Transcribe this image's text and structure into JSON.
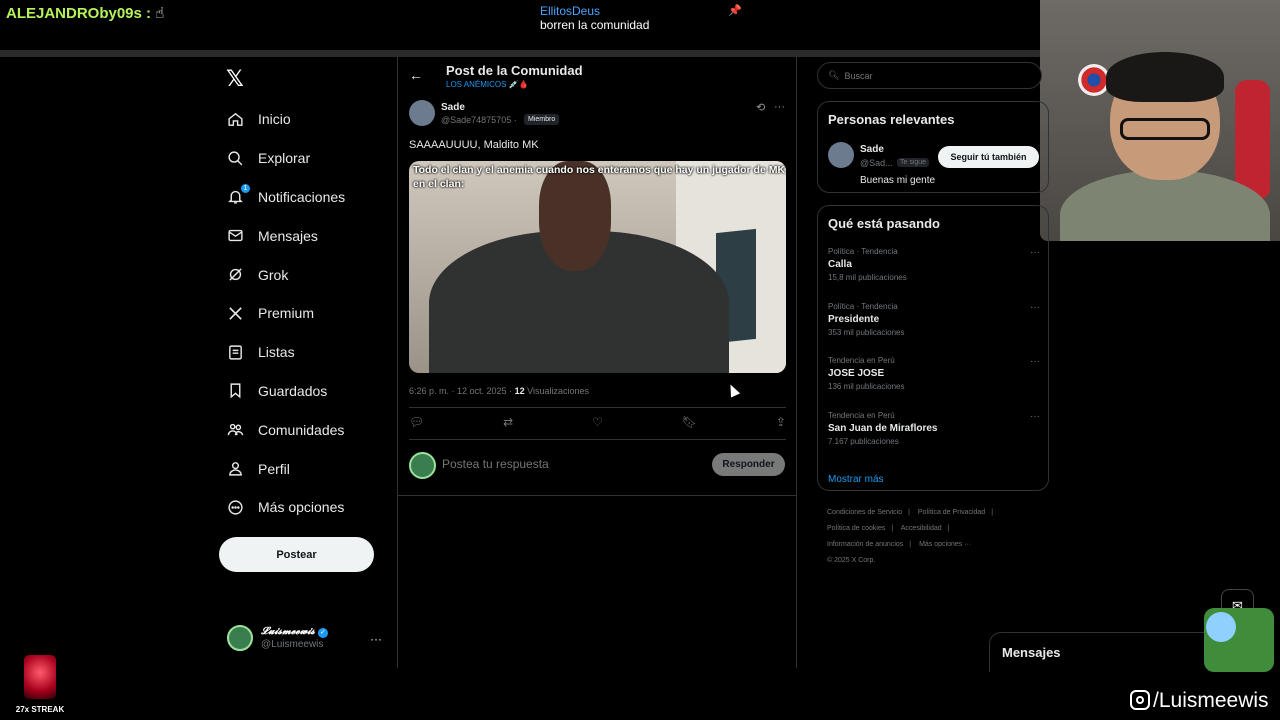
{
  "stream": {
    "chat_left": {
      "user": "ALEJANDROby09s",
      "sep": ":",
      "emoji": "☝"
    },
    "chat_center": {
      "user": "EllitosDeus",
      "message": "borren la comunidad"
    },
    "streak_label": "27x STREAK",
    "instagram": "/Luismeewis"
  },
  "nav": {
    "logo": "𝕏",
    "items": [
      {
        "label": "Inicio",
        "icon": "home-icon"
      },
      {
        "label": "Explorar",
        "icon": "search-icon"
      },
      {
        "label": "Notificaciones",
        "icon": "bell-icon",
        "badge": "1"
      },
      {
        "label": "Mensajes",
        "icon": "mail-icon"
      },
      {
        "label": "Grok",
        "icon": "grok-icon"
      },
      {
        "label": "Premium",
        "icon": "x-icon"
      },
      {
        "label": "Listas",
        "icon": "list-icon"
      },
      {
        "label": "Guardados",
        "icon": "bookmark-icon"
      },
      {
        "label": "Comunidades",
        "icon": "people-icon"
      },
      {
        "label": "Perfil",
        "icon": "person-icon"
      },
      {
        "label": "Más opciones",
        "icon": "more-circle-icon"
      }
    ],
    "post_button": "Postear",
    "account": {
      "display_name": "𝓛𝓾𝓲𝓼𝓶𝓮𝓮𝔀𝓲𝓼",
      "handle": "@Luismeewis",
      "more": "···"
    }
  },
  "post": {
    "header_title": "Post de la Comunidad",
    "header_sub": "LOS ANÉMICOS 💉🩸",
    "author": "Sade",
    "handle": "@Sade74875705 ·",
    "member_tag": "Miembro",
    "text": "SAAAAUUUU, Maldito MK",
    "media_caption": "Todo el clan  y el anemia cuando nos enteramos que hay un jugador de MK en el clan:",
    "time": "6:26 p. m. · 12 oct. 2025 ·",
    "views_count": "12",
    "views_label": "Visualizaciones",
    "reply_placeholder": "Postea tu respuesta",
    "reply_button": "Responder"
  },
  "right": {
    "search_placeholder": "Buscar",
    "relevant": {
      "title": "Personas relevantes",
      "name": "Sade",
      "handle": "@Sad...",
      "tag": "Te sigue",
      "follow_button": "Seguir tú también",
      "bio": "Buenas mi gente"
    },
    "trends": {
      "title": "Qué está pasando",
      "items": [
        {
          "category": "Política · Tendencia",
          "name": "Calla",
          "count": "15,8 mil publicaciones"
        },
        {
          "category": "Política · Tendencia",
          "name": "Presidente",
          "count": "353 mil publicaciones"
        },
        {
          "category": "Tendencia en Perú",
          "name": "JOSE JOSE",
          "count": "136 mil publicaciones"
        },
        {
          "category": "Tendencia en Perú",
          "name": "San Juan de Miraflores",
          "count": "7.167 publicaciones"
        }
      ],
      "show_more": "Mostrar más"
    },
    "footer": {
      "links": [
        "Condiciones de Servicio",
        "|",
        "Política de Privacidad",
        "|",
        "Política de cookies",
        "|",
        "Accesibilidad",
        "|",
        "Información de anuncios",
        "|",
        "Más opciones ···"
      ],
      "copyright": "© 2025 X Corp."
    },
    "messages_drawer": "Mensajes"
  }
}
